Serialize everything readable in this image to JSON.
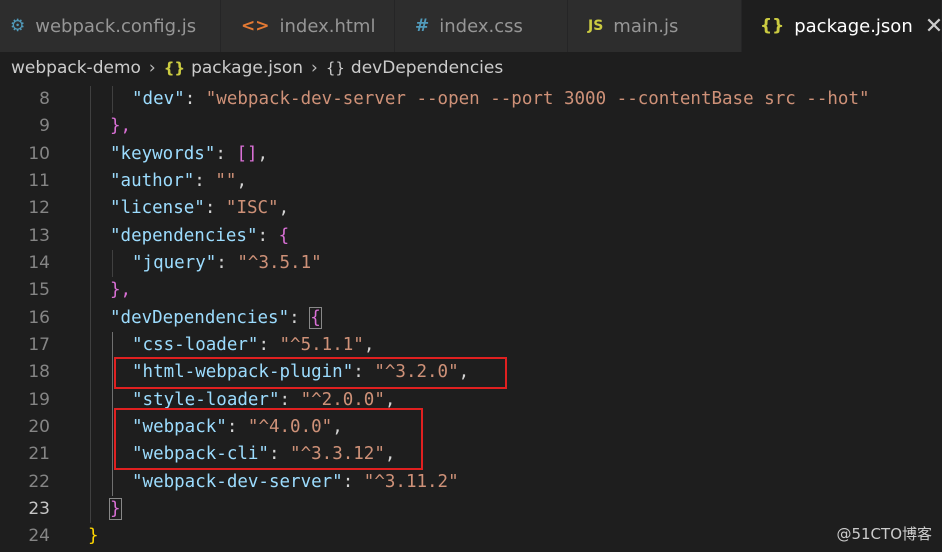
{
  "tabs": [
    {
      "icon": "⚙",
      "label": "webpack.config.js",
      "color": "#519aba"
    },
    {
      "icon": "<>",
      "label": "index.html",
      "color": "#e37933"
    },
    {
      "icon": "#",
      "label": "index.css",
      "color": "#519aba"
    },
    {
      "icon": "JS",
      "label": "main.js",
      "color": "#cbcb41"
    },
    {
      "icon": "{}",
      "label": "package.json",
      "color": "#cbcb41",
      "close": "✕"
    }
  ],
  "breadcrumb": {
    "folder": "webpack-demo",
    "file_icon": "{}",
    "file": "package.json",
    "symbol_icon": "{}",
    "symbol": "devDependencies",
    "sep": "›"
  },
  "lines": [
    {
      "n": "8",
      "t1": "\"dev\"",
      "t2": ": ",
      "t3": "\"webpack-dev-server --open --port 3000 --contentBase src --hot\"",
      "t4": ""
    },
    {
      "n": "9",
      "t1": "},",
      "t2": "",
      "t3": "",
      "t4": ""
    },
    {
      "n": "10",
      "t1": "\"keywords\"",
      "t2": ": ",
      "t3": "[]",
      "t4": ","
    },
    {
      "n": "11",
      "t1": "\"author\"",
      "t2": ": ",
      "t3": "\"\"",
      "t4": ","
    },
    {
      "n": "12",
      "t1": "\"license\"",
      "t2": ": ",
      "t3": "\"ISC\"",
      "t4": ","
    },
    {
      "n": "13",
      "t1": "\"dependencies\"",
      "t2": ": ",
      "t3": "{",
      "t4": ""
    },
    {
      "n": "14",
      "t1": "\"jquery\"",
      "t2": ": ",
      "t3": "\"^3.5.1\"",
      "t4": ""
    },
    {
      "n": "15",
      "t1": "},",
      "t2": "",
      "t3": "",
      "t4": ""
    },
    {
      "n": "16",
      "t1": "\"devDependencies\"",
      "t2": ": ",
      "t3": "{",
      "t4": ""
    },
    {
      "n": "17",
      "t1": "\"css-loader\"",
      "t2": ": ",
      "t3": "\"^5.1.1\"",
      "t4": ","
    },
    {
      "n": "18",
      "t1": "\"html-webpack-plugin\"",
      "t2": ": ",
      "t3": "\"^3.2.0\"",
      "t4": ","
    },
    {
      "n": "19",
      "t1": "\"style-loader\"",
      "t2": ": ",
      "t3": "\"^2.0.0\"",
      "t4": ","
    },
    {
      "n": "20",
      "t1": "\"webpack\"",
      "t2": ": ",
      "t3": "\"^4.0.0\"",
      "t4": ","
    },
    {
      "n": "21",
      "t1": "\"webpack-cli\"",
      "t2": ": ",
      "t3": "\"^3.3.12\"",
      "t4": ","
    },
    {
      "n": "22",
      "t1": "\"webpack-dev-server\"",
      "t2": ": ",
      "t3": "\"^3.11.2\"",
      "t4": ""
    },
    {
      "n": "23",
      "t1": "}",
      "t2": "",
      "t3": "",
      "t4": ""
    },
    {
      "n": "24",
      "t1": "}",
      "t2": "",
      "t3": "",
      "t4": ""
    }
  ],
  "watermark": "@51CTO博客"
}
